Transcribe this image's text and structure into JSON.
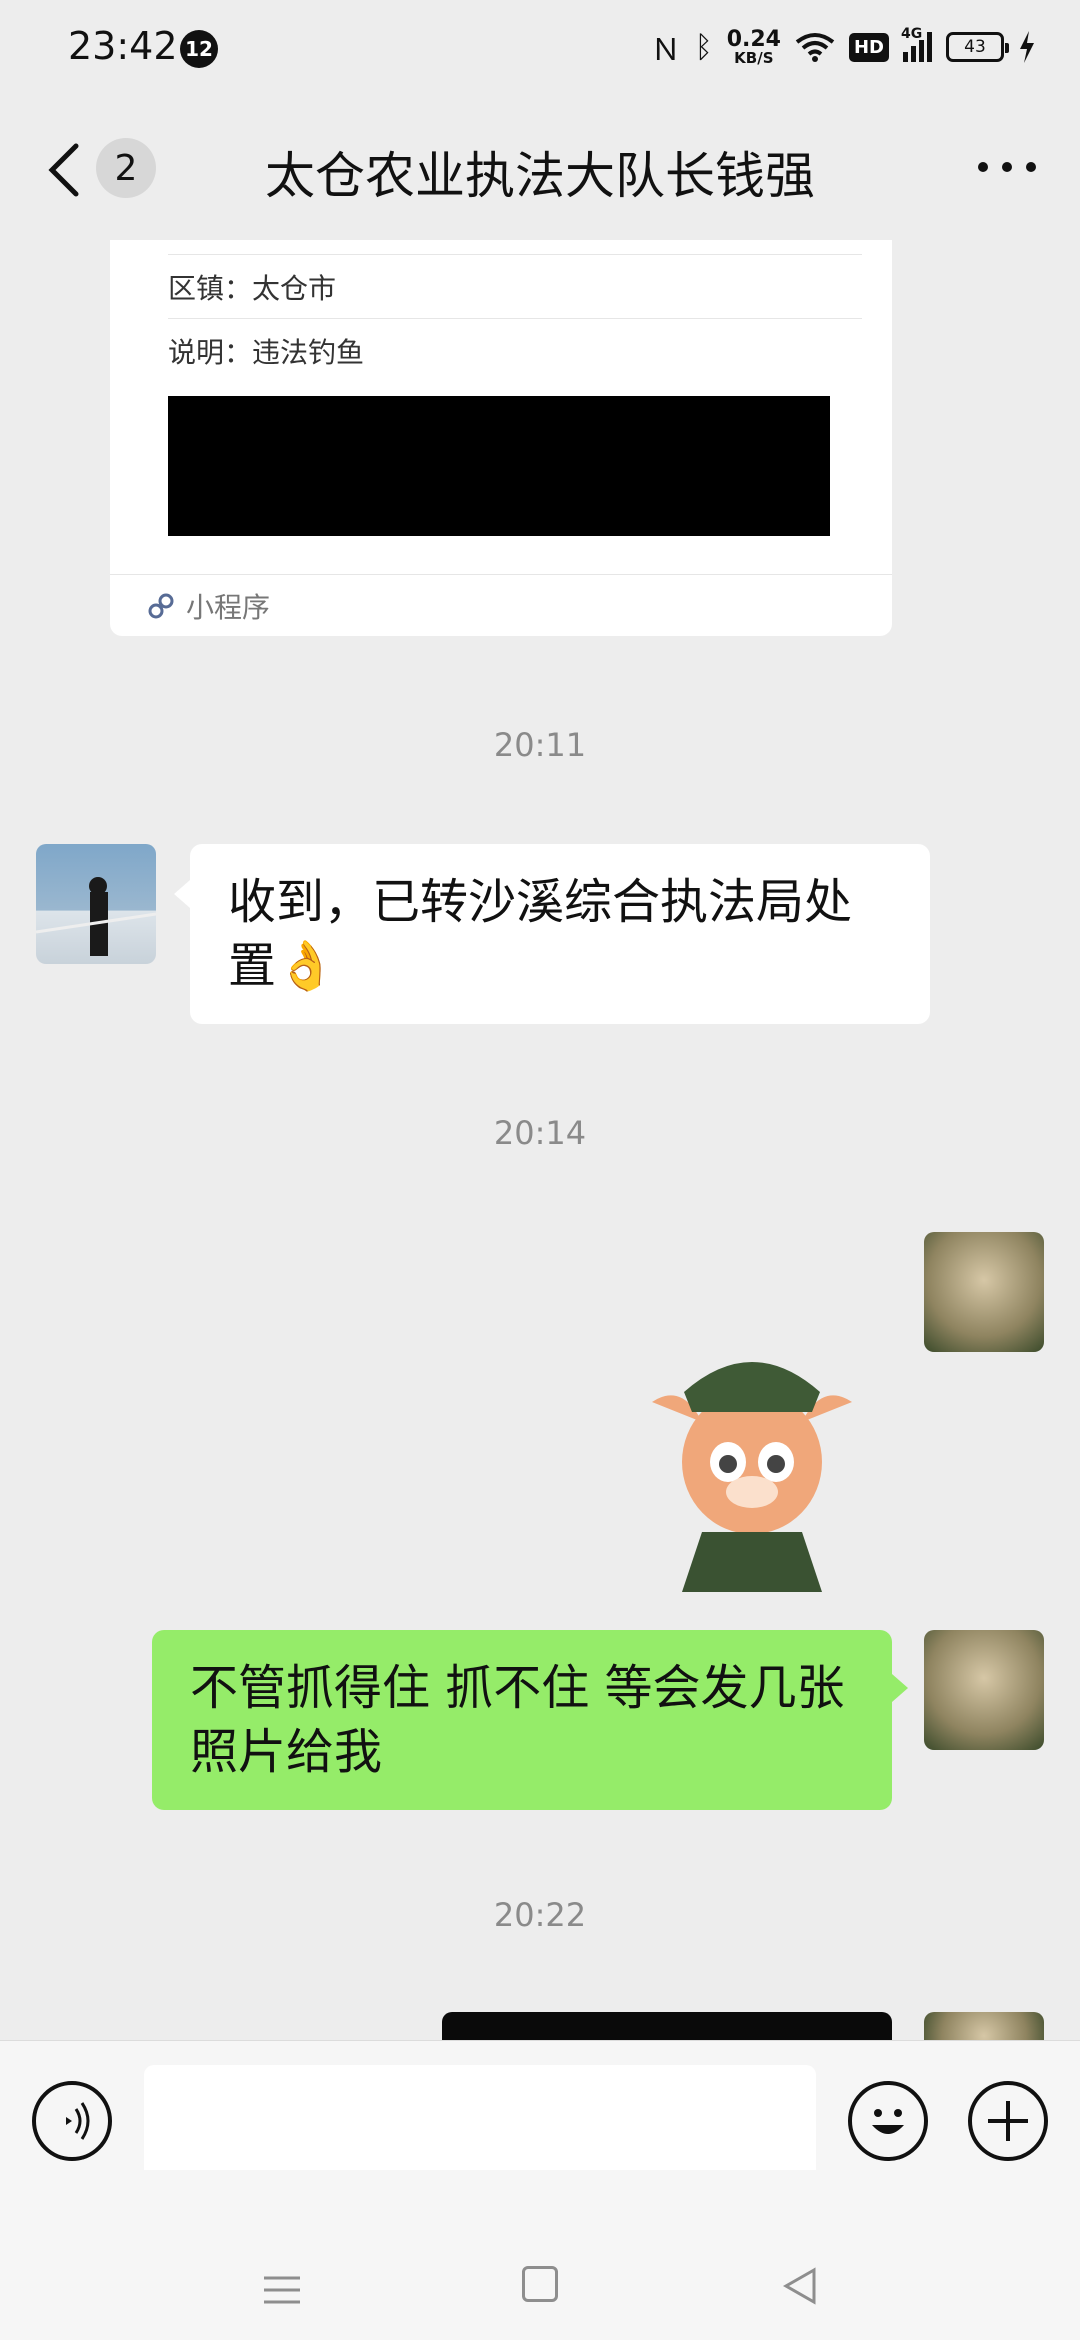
{
  "status_bar": {
    "time": "23:42",
    "notification_count": "12",
    "net_speed_value": "0.24",
    "net_speed_unit": "KB/S",
    "hd_label": "HD",
    "network_type": "4G",
    "battery": "43"
  },
  "nav": {
    "unread_count": "2",
    "title": "太仓农业执法大队长钱强"
  },
  "card": {
    "district_label": "区镇：太仓市",
    "note_label": "说明：违法钓鱼",
    "source_label": "小程序"
  },
  "messages": {
    "time_1": "20:11",
    "reply_in": "收到，已转沙溪综合执法局处置👌",
    "time_2": "20:14",
    "reply_out": "不管抓得住 抓不住 等会发几张照片给我",
    "time_3": "20:22"
  },
  "input": {
    "placeholder": ""
  },
  "colors": {
    "background": "#ededed",
    "incoming_bubble": "#ffffff",
    "outgoing_bubble": "#95ec69"
  },
  "icons": [
    "back-icon",
    "more-icon",
    "mini-program-icon",
    "voice-icon",
    "emoji-icon",
    "plus-icon",
    "menu-icon",
    "home-icon",
    "back-nav-icon"
  ]
}
